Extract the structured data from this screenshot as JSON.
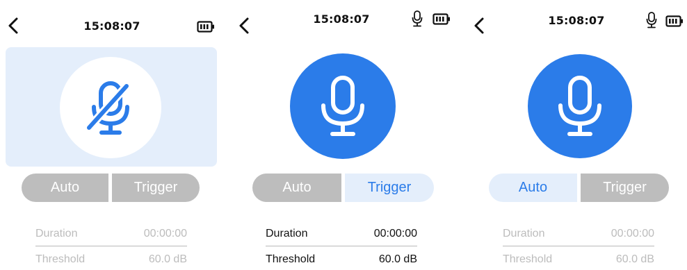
{
  "colors": {
    "accent": "#2b7ce9",
    "accent_light": "#e4eefb",
    "inactive": "#bdbdbd"
  },
  "screens": [
    {
      "time": "15:08:07",
      "status_icons": [
        "battery-icon"
      ],
      "main_icon": "mic-off-icon",
      "segment": {
        "auto_label": "Auto",
        "trigger_label": "Trigger",
        "selected": "none"
      },
      "stats": [
        {
          "label": "Duration",
          "value": "00:00:00"
        },
        {
          "label": "Threshold",
          "value": "60.0 dB"
        }
      ]
    },
    {
      "time": "15:08:07",
      "status_icons": [
        "mic-icon",
        "battery-icon"
      ],
      "main_icon": "mic-icon",
      "segment": {
        "auto_label": "Auto",
        "trigger_label": "Trigger",
        "selected": "Trigger"
      },
      "stats": [
        {
          "label": "Duration",
          "value": "00:00:00"
        },
        {
          "label": "Threshold",
          "value": "60.0 dB"
        }
      ]
    },
    {
      "time": "15:08:07",
      "status_icons": [
        "mic-icon",
        "battery-icon"
      ],
      "main_icon": "mic-icon",
      "segment": {
        "auto_label": "Auto",
        "trigger_label": "Trigger",
        "selected": "Auto"
      },
      "stats": [
        {
          "label": "Duration",
          "value": "00:00:00"
        },
        {
          "label": "Threshold",
          "value": "60.0 dB"
        }
      ]
    }
  ]
}
